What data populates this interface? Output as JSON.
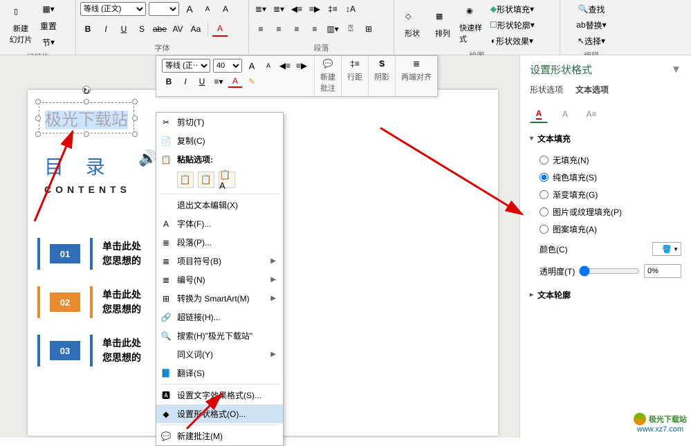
{
  "ribbon": {
    "slide": {
      "new": "新建\n幻灯片",
      "reset": "重置",
      "section": "节",
      "group": "幻灯片"
    },
    "font": {
      "family": "等线 (正文)",
      "group": "字体",
      "bold": "B",
      "italic": "I",
      "underline": "U",
      "shadow_s": "S",
      "strike": "abe",
      "spacing": "AV",
      "case": "Aa",
      "grow": "A",
      "shrink": "A",
      "clear": "A",
      "color_a": "A"
    },
    "para": {
      "group": "段落",
      "bullets": "≡",
      "numbers": "≡",
      "indent_dec": "≡",
      "indent_inc": "≡",
      "direction": "↕",
      "align_l": "≡",
      "align_c": "≡",
      "align_r": "≡",
      "align_j": "≡",
      "columns": "≣",
      "smartart": "⊞"
    },
    "draw": {
      "shape": "形状",
      "arrange": "排列",
      "quick": "快速样式",
      "fill": "形状填充",
      "outline": "形状轮廓",
      "effects": "形状效果",
      "group": "绘图"
    },
    "edit": {
      "find": "查找",
      "replace": "替换",
      "select": "选择",
      "group": "编辑"
    }
  },
  "float": {
    "family": "等线 (正⋯",
    "size": "40",
    "grow": "A",
    "shrink": "A",
    "bold": "B",
    "italic": "I",
    "underline": "U",
    "align": "≡",
    "color_a": "A",
    "highlight": "✎",
    "new_comment": "新建\n批注",
    "linespace": "行距",
    "shadow": "阴影",
    "justify": "两端对齐"
  },
  "slide_content": {
    "seltext": "极光下载站",
    "heading_cn": "目 录",
    "heading_en": "CONTENTS",
    "items": [
      {
        "num": "01",
        "color": "#2f6fb7",
        "line1": "单击此处",
        "line2": "您思想的"
      },
      {
        "num": "02",
        "color": "#e78b2f",
        "line1": "单击此处",
        "line2": "您思想的"
      },
      {
        "num": "03",
        "color": "#2f6fb7",
        "line1": "单击此处",
        "line2": "您思想的"
      }
    ]
  },
  "ctx": {
    "cut": "剪切(T)",
    "copy": "复制(C)",
    "paste_label": "粘贴选项:",
    "exit_edit": "退出文本编辑(X)",
    "font": "字体(F)...",
    "para": "段落(P)...",
    "bullets": "项目符号(B)",
    "numbering": "编号(N)",
    "smartart": "转换为 SmartArt(M)",
    "hyperlink": "超链接(H)...",
    "search": "搜索(H)\"极光下载站\"",
    "synonym": "同义词(Y)",
    "translate": "翻译(S)",
    "text_effect": "设置文字效果格式(S)...",
    "shape_format": "设置形状格式(O)...",
    "new_comment": "新建批注(M)"
  },
  "panel": {
    "title": "设置形状格式",
    "tab_shape": "形状选项",
    "tab_text": "文本选项",
    "section_fill": "文本填充",
    "fill_none": "无填充(N)",
    "fill_solid": "纯色填充(S)",
    "fill_gradient": "渐变填充(G)",
    "fill_picture": "图片或纹理填充(P)",
    "fill_pattern": "图案填充(A)",
    "color_label": "颜色(C)",
    "trans_label": "透明度(T)",
    "trans_value": "0%",
    "section_outline": "文本轮廓"
  },
  "watermark": {
    "name": "极光下载站",
    "url": "www.xz7.com"
  }
}
